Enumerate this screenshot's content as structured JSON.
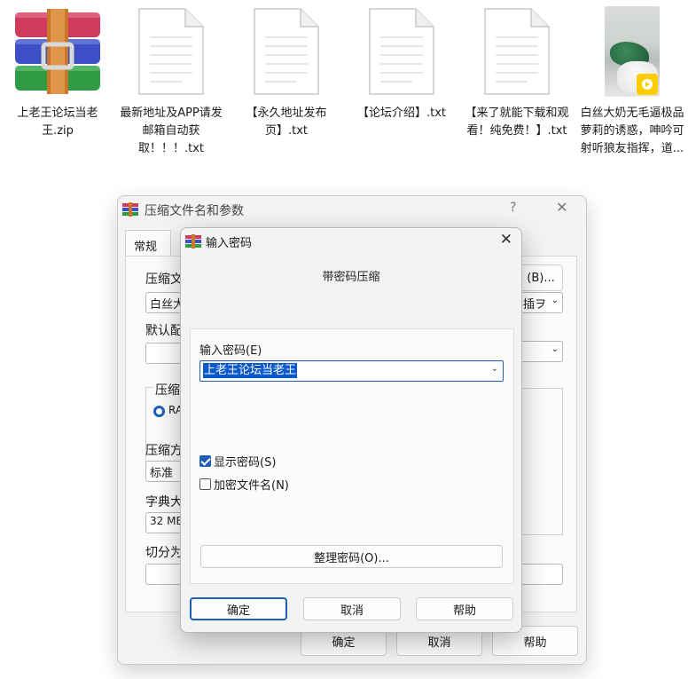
{
  "desktop": {
    "files": [
      {
        "name": "上老王论坛当老王.zip",
        "icon": "winrar-archive-icon"
      },
      {
        "name": "最新地址及APP请发邮箱自动获取！！！.txt",
        "icon": "text-document-icon"
      },
      {
        "name": "【永久地址发布页】.txt",
        "icon": "text-document-icon"
      },
      {
        "name": "【论坛介绍】.txt",
        "icon": "text-document-icon"
      },
      {
        "name": "【来了就能下载和观看！纯免费！】.txt",
        "icon": "text-document-icon"
      },
      {
        "name": "白丝大奶无毛逼极品萝莉的诱惑，呻吟可射听狼友指挥，道...",
        "icon": "video-thumbnail",
        "badge": "Player"
      }
    ]
  },
  "back_dialog": {
    "title": "压缩文件名和参数",
    "help": "?",
    "close": "✕",
    "tab": "常规",
    "labels": {
      "archive_name": "压缩文",
      "default": "默认配",
      "format": "压缩",
      "method": "压缩方",
      "dict": "字典大",
      "split": "切分为"
    },
    "values": {
      "archive_name": "白丝大",
      "format_radio": "RA",
      "method": "标准",
      "dict": "32 MB",
      "right_combo": "插ヲ"
    },
    "browse_button": "(B)...",
    "buttons": {
      "ok": "确定",
      "cancel": "取消",
      "help": "帮助"
    }
  },
  "password_dialog": {
    "title": "输入密码",
    "close": "✕",
    "subtitle": "带密码压缩",
    "password_label": "输入密码(E)",
    "password_value": "上老王论坛当老王",
    "show_password": {
      "label": "显示密码(S)",
      "checked": true
    },
    "encrypt_names": {
      "label": "加密文件名(N)",
      "checked": false
    },
    "organize_button": "整理密码(O)...",
    "buttons": {
      "ok": "确定",
      "cancel": "取消",
      "help": "帮助"
    }
  },
  "colors": {
    "accent": "#1f5fb8",
    "selection": "#0a58c9",
    "badge": "#ffcc00"
  }
}
